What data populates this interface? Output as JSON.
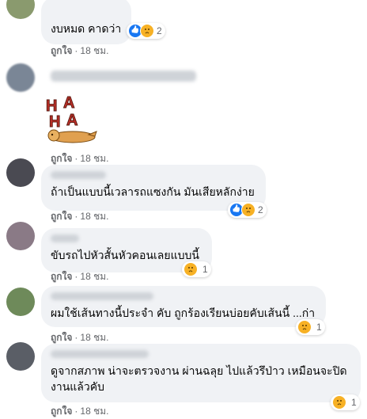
{
  "comments": [
    {
      "text": "งบหมด คาดว่า",
      "actions": {
        "like": "ถูกใจ",
        "time": "18 ชม."
      },
      "reaction_count": "2"
    },
    {
      "text": "",
      "sticker": {
        "letters": [
          "H",
          "A",
          "H",
          "A"
        ]
      },
      "actions": {
        "like": "ถูกใจ",
        "time": "18 ชม."
      }
    },
    {
      "text": "ถ้าเป็นแบบนี้เวลารถแซงกัน มันเสียหลักง่าย",
      "actions": {
        "like": "ถูกใจ",
        "time": "18 ชม."
      },
      "reaction_count": "2"
    },
    {
      "text": "ขับรถไปหัวสั้นหัวคอนเลยแบบนี้",
      "actions": {
        "like": "ถูกใจ",
        "time": "18 ชม."
      },
      "reaction_count": "1"
    },
    {
      "text": "ผมใช้เส้นทางนี้ประจำ คับ ถูกร้องเรียนบ่อยคับเส้นนี้ ...ก่า",
      "actions": {
        "like": "ถูกใจ",
        "time": "18 ชม."
      },
      "reaction_count": "1"
    },
    {
      "text": "ดูจากสภาพ น่าจะตรวจงาน ผ่านฉลุย ไปแล้วรึป่าว เหมือนจะปิดงานแล้วคับ",
      "actions": {
        "like": "ถูกใจ",
        "time": "18 ชม."
      },
      "reaction_count": "1"
    }
  ],
  "colors": {
    "bubble_bg": "#f0f2f5",
    "like_blue": "#1877f2",
    "sad_yellow": "#f7b125",
    "secondary_text": "#65676b"
  }
}
